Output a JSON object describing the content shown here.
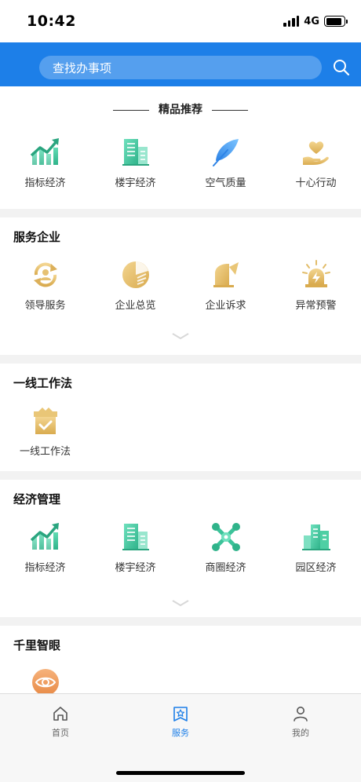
{
  "status": {
    "time": "10:42",
    "network": "4G"
  },
  "search": {
    "placeholder": "查找办事项"
  },
  "featured": {
    "title": "精品推荐",
    "items": [
      {
        "label": "指标经济",
        "icon": "trend-chart-icon"
      },
      {
        "label": "楼宇经济",
        "icon": "building-icon"
      },
      {
        "label": "空气质量",
        "icon": "feather-icon"
      },
      {
        "label": "十心行动",
        "icon": "heart-hand-icon"
      }
    ]
  },
  "service": {
    "title": "服务企业",
    "items": [
      {
        "label": "领导服务",
        "icon": "leader-service-icon"
      },
      {
        "label": "企业总览",
        "icon": "pie-chart-icon"
      },
      {
        "label": "企业诉求",
        "icon": "writing-icon"
      },
      {
        "label": "异常预警",
        "icon": "alarm-light-icon"
      }
    ]
  },
  "work": {
    "title": "一线工作法",
    "items": [
      {
        "label": "一线工作法",
        "icon": "checkbox-crate-icon"
      }
    ]
  },
  "econ": {
    "title": "经济管理",
    "items": [
      {
        "label": "指标经济",
        "icon": "trend-chart-icon"
      },
      {
        "label": "楼宇经济",
        "icon": "building-icon"
      },
      {
        "label": "商圈经济",
        "icon": "network-cross-icon"
      },
      {
        "label": "园区经济",
        "icon": "park-buildings-icon"
      }
    ]
  },
  "eye": {
    "title": "千里智眼",
    "icon": "eye-icon"
  },
  "tabs": [
    {
      "label": "首页",
      "icon": "home-icon",
      "active": false
    },
    {
      "label": "服务",
      "icon": "bookmark-star-icon",
      "active": true
    },
    {
      "label": "我的",
      "icon": "person-icon",
      "active": false
    }
  ],
  "colors": {
    "primary": "#1d7fe8",
    "green": "#34c49a",
    "gold": "#e2bd6a",
    "blue_feather": "#4a9ef0",
    "orange": "#ef9a57"
  }
}
